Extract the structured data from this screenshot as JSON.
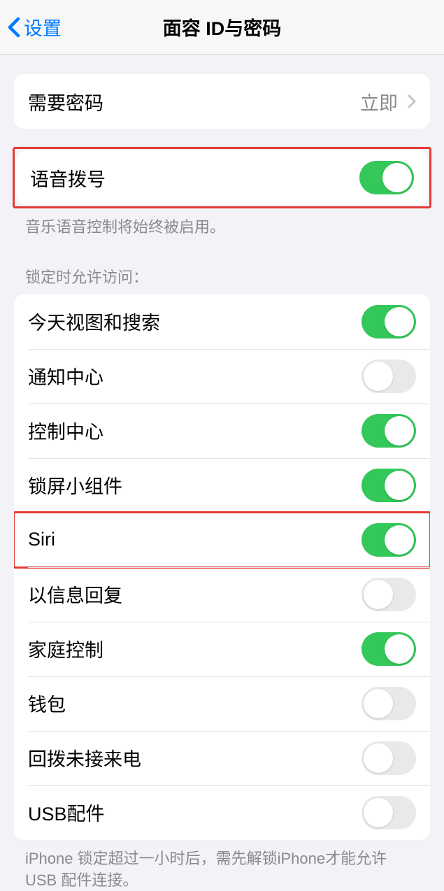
{
  "header": {
    "back_label": "设置",
    "title": "面容 ID与密码"
  },
  "require_passcode": {
    "label": "需要密码",
    "value": "立即"
  },
  "voice_dial": {
    "label": "语音拨号",
    "footer": "音乐语音控制将始终被启用。"
  },
  "lock_section": {
    "header": "锁定时允许访问：",
    "items": {
      "today": {
        "label": "今天视图和搜索"
      },
      "notification": {
        "label": "通知中心"
      },
      "control": {
        "label": "控制中心"
      },
      "widgets": {
        "label": "锁屏小组件"
      },
      "siri": {
        "label": "Siri"
      },
      "reply": {
        "label": "以信息回复"
      },
      "home": {
        "label": "家庭控制"
      },
      "wallet": {
        "label": "钱包"
      },
      "callback": {
        "label": "回拨未接来电"
      },
      "usb": {
        "label": "USB配件"
      }
    },
    "footer": "iPhone 锁定超过一小时后，需先解锁iPhone才能允许 USB 配件连接。"
  }
}
